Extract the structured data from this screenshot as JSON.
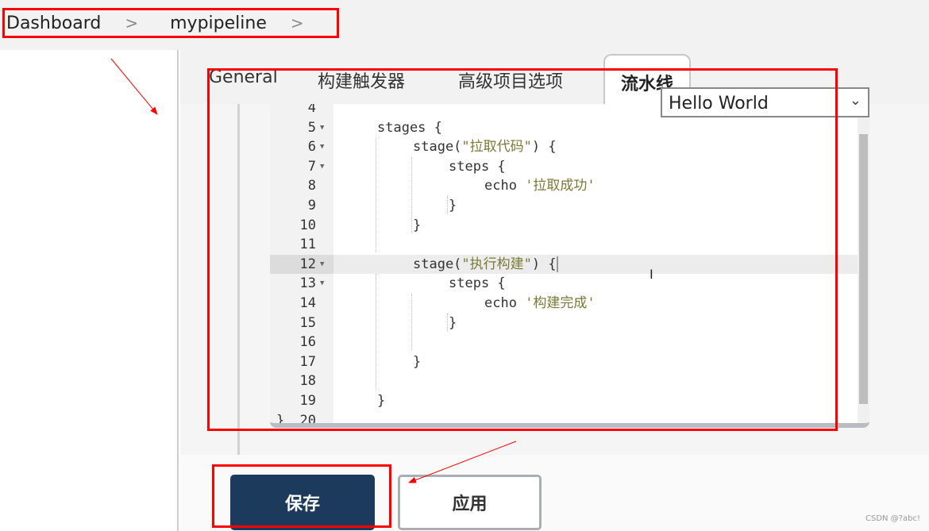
{
  "breadcrumb": {
    "items": [
      "Dashboard",
      "mypipeline"
    ],
    "separator": ">"
  },
  "tabs": [
    {
      "label": "General",
      "active": false
    },
    {
      "label": "构建触发器",
      "active": false
    },
    {
      "label": "高级项目选项",
      "active": false
    },
    {
      "label": "流水线",
      "active": true
    }
  ],
  "sample_select": {
    "value": "Hello World"
  },
  "editor": {
    "lines": [
      {
        "n": "4",
        "fold": false,
        "indent": 0,
        "parts": []
      },
      {
        "n": "5",
        "fold": true,
        "indent": 1,
        "parts": [
          {
            "t": "stages {"
          }
        ]
      },
      {
        "n": "6",
        "fold": true,
        "indent": 2,
        "parts": [
          {
            "t": "stage("
          },
          {
            "t": "\"拉取代码\"",
            "s": 1
          },
          {
            "t": ") {"
          }
        ]
      },
      {
        "n": "7",
        "fold": true,
        "indent": 3,
        "parts": [
          {
            "t": "steps {"
          }
        ]
      },
      {
        "n": "8",
        "fold": false,
        "indent": 4,
        "parts": [
          {
            "t": "echo "
          },
          {
            "t": "'拉取成功'",
            "s": 1
          }
        ]
      },
      {
        "n": "9",
        "fold": false,
        "indent": 3,
        "parts": [
          {
            "t": "}"
          }
        ]
      },
      {
        "n": "10",
        "fold": false,
        "indent": 2,
        "parts": [
          {
            "t": "}"
          }
        ]
      },
      {
        "n": "11",
        "fold": false,
        "indent": 0,
        "parts": []
      },
      {
        "n": "12",
        "fold": true,
        "indent": 2,
        "active": true,
        "parts": [
          {
            "t": "stage("
          },
          {
            "t": "\"执行构建\"",
            "s": 1
          },
          {
            "t": ") {"
          }
        ]
      },
      {
        "n": "13",
        "fold": true,
        "indent": 3,
        "parts": [
          {
            "t": "steps {"
          }
        ]
      },
      {
        "n": "14",
        "fold": false,
        "indent": 4,
        "parts": [
          {
            "t": "echo "
          },
          {
            "t": "'构建完成'",
            "s": 1
          }
        ]
      },
      {
        "n": "15",
        "fold": false,
        "indent": 3,
        "parts": [
          {
            "t": "}"
          }
        ]
      },
      {
        "n": "16",
        "fold": false,
        "indent": 0,
        "parts": []
      },
      {
        "n": "17",
        "fold": false,
        "indent": 2,
        "parts": [
          {
            "t": "}"
          }
        ]
      },
      {
        "n": "18",
        "fold": false,
        "indent": 0,
        "parts": []
      },
      {
        "n": "19",
        "fold": false,
        "indent": 1,
        "parts": [
          {
            "t": "}"
          }
        ]
      },
      {
        "n": "20",
        "fold": false,
        "indent": 0,
        "parts": [
          {
            "t": "}"
          }
        ]
      }
    ]
  },
  "buttons": {
    "save": "保存",
    "apply": "应用"
  },
  "watermark": "CSDN @?abc!",
  "colors": {
    "annotation": "#ff0000",
    "primary_button": "#1b3a5c"
  }
}
